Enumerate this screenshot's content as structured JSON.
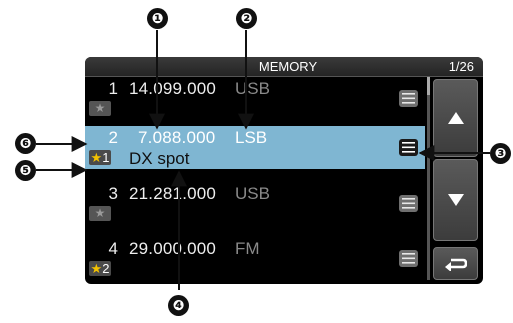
{
  "screen": {
    "title": "MEMORY",
    "page": "1/26"
  },
  "rows": [
    {
      "num": "1",
      "freq": "14.099.000",
      "mode": "USB",
      "star": "★",
      "name": ""
    },
    {
      "num": "2",
      "freq": "7.088.000",
      "mode": "LSB",
      "star_glyph": "★",
      "star_group": "1",
      "name": "DX spot"
    },
    {
      "num": "3",
      "freq": "21.281.000",
      "mode": "USB",
      "star": "★",
      "name": ""
    },
    {
      "num": "4",
      "freq": "29.000.000",
      "mode": "FM",
      "star_glyph": "★",
      "star_group": "2",
      "name": ""
    }
  ],
  "selected_row_index": 1,
  "scroll_position": 0.0,
  "buttons": {
    "up": "up-arrow-icon",
    "down": "down-arrow-icon",
    "back": "return-icon"
  },
  "callouts": [
    "❶",
    "❷",
    "❸",
    "❹",
    "❺",
    "❻"
  ],
  "colors": {
    "selected_row": "#7fb6d2",
    "screen_background": "#000000",
    "star_accent": "#f3c200"
  }
}
